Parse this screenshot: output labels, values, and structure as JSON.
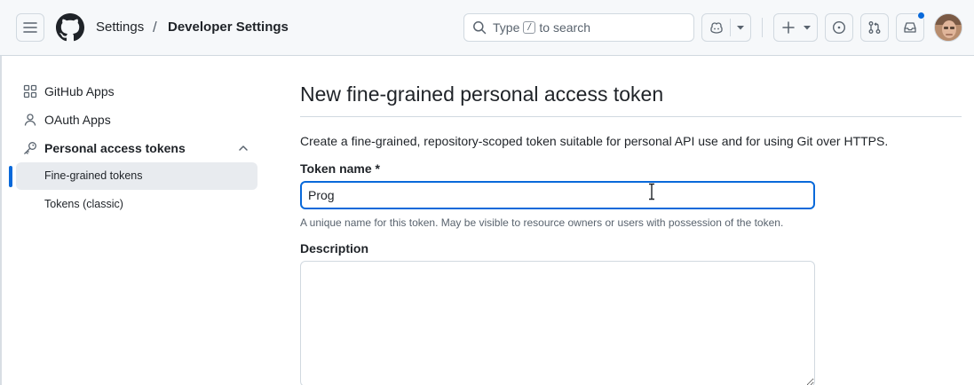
{
  "header": {
    "breadcrumb": {
      "root": "Settings",
      "separator": "/",
      "current": "Developer Settings"
    },
    "search": {
      "prefix": "Type",
      "key": "/",
      "suffix": "to search"
    }
  },
  "sidebar": {
    "items": [
      {
        "label": "GitHub Apps",
        "icon": "apps-grid-icon"
      },
      {
        "label": "OAuth Apps",
        "icon": "person-icon"
      },
      {
        "label": "Personal access tokens",
        "icon": "key-icon",
        "expanded": true
      }
    ],
    "subitems": [
      {
        "label": "Fine-grained tokens",
        "active": true
      },
      {
        "label": "Tokens (classic)",
        "active": false
      }
    ]
  },
  "main": {
    "title": "New fine-grained personal access token",
    "lead": "Create a fine-grained, repository-scoped token suitable for personal API use and for using Git over HTTPS.",
    "token_name": {
      "label": "Token name *",
      "value": "Prog",
      "hint": "A unique name for this token. May be visible to resource owners or users with possession of the token."
    },
    "description": {
      "label": "Description",
      "value": ""
    }
  },
  "colors": {
    "accent": "#0969da",
    "border": "#d1d9e0",
    "muted": "#59636e",
    "header_bg": "#f6f8fa",
    "active_bg": "#e8ebef"
  }
}
